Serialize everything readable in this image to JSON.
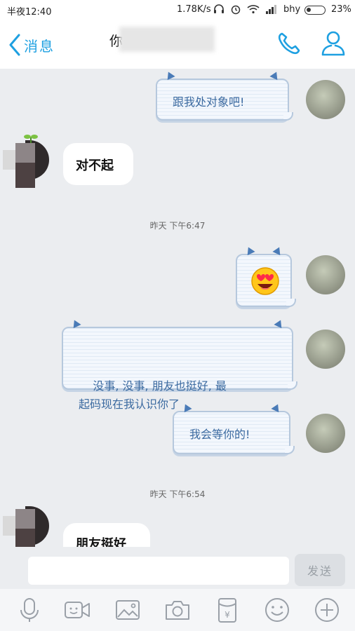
{
  "status_bar": {
    "time": "半夜12:40",
    "speed": "1.78K/s",
    "carrier": "bhy",
    "battery": "23%"
  },
  "header": {
    "back_label": "消息",
    "title": "你                    事.~"
  },
  "messages": [
    {
      "side": "right",
      "text": "跟我处对象吧!"
    },
    {
      "side": "left",
      "text": "对不起"
    },
    {
      "type": "time",
      "text": "昨天 下午6:47"
    },
    {
      "side": "right",
      "emoji": "heart-eyes"
    },
    {
      "side": "right",
      "text": "没事, 没事, 朋友也挺好, 最\n起码现在我认识你了"
    },
    {
      "side": "right",
      "text": "我会等你的!"
    },
    {
      "type": "time",
      "text": "昨天 下午6:54"
    },
    {
      "side": "left",
      "text": "朋友挺好"
    }
  ],
  "input": {
    "value": "",
    "send_label": "发送"
  },
  "toolbar": [
    "microphone-icon",
    "video-icon",
    "image-icon",
    "camera-icon",
    "red-packet-icon",
    "emoji-icon",
    "plus-icon"
  ],
  "colors": {
    "accent": "#1ea0e1",
    "bubble_text": "#3b6aa0"
  }
}
